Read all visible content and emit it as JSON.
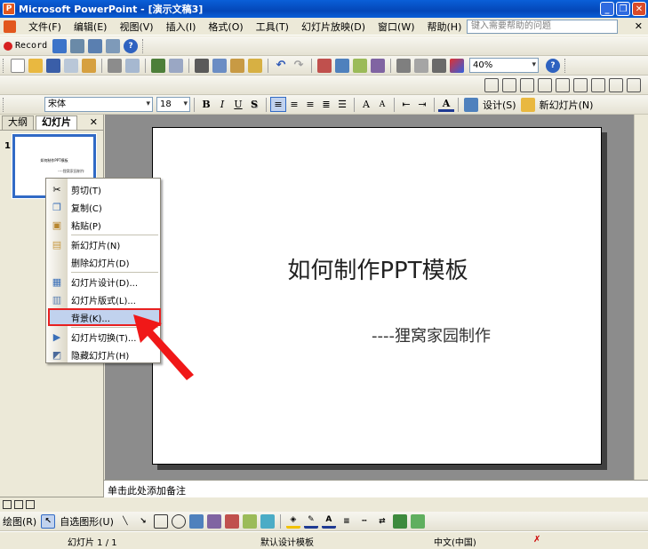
{
  "titlebar": {
    "title": "Microsoft PowerPoint - [演示文稿3]",
    "app_icon": "P",
    "minimize": "_",
    "restore": "❐",
    "close": "✕"
  },
  "menubar": {
    "items": [
      "文件(F)",
      "编辑(E)",
      "视图(V)",
      "插入(I)",
      "格式(O)",
      "工具(T)",
      "幻灯片放映(D)",
      "窗口(W)",
      "帮助(H)"
    ],
    "help_placeholder": "键入需要帮助的问题",
    "doc_close": "✕"
  },
  "toolbar_record": {
    "label": "Record"
  },
  "toolbar_standard": {
    "zoom": "40%"
  },
  "toolbar_format": {
    "font": "宋体",
    "size": "18",
    "bold": "B",
    "italic": "I",
    "underline": "U",
    "shadow": "S",
    "design_label": "设计(S)",
    "new_slide_label": "新幻灯片(N)"
  },
  "leftpane": {
    "tabs": [
      "大纲",
      "幻灯片"
    ],
    "close": "✕",
    "slide_number": "1",
    "thumb_title": "如何制作PPT模板",
    "thumb_sub": "----狸窝家园制作"
  },
  "slide": {
    "title": "如何制作PPT模板",
    "subtitle": "----狸窝家园制作"
  },
  "context_menu": {
    "items": [
      {
        "label": "剪切(T)",
        "icon": "scissors-icon"
      },
      {
        "label": "复制(C)",
        "icon": "copy-icon"
      },
      {
        "label": "粘贴(P)",
        "icon": "paste-icon"
      },
      {
        "label": "新幻灯片(N)",
        "icon": "new-slide-icon"
      },
      {
        "label": "删除幻灯片(D)",
        "icon": ""
      },
      {
        "label": "幻灯片设计(D)...",
        "icon": "slide-design-icon"
      },
      {
        "label": "幻灯片版式(L)...",
        "icon": "slide-layout-icon"
      },
      {
        "label": "背景(K)...",
        "icon": ""
      },
      {
        "label": "幻灯片切换(T)...",
        "icon": "transition-icon"
      },
      {
        "label": "隐藏幻灯片(H)",
        "icon": "hide-slide-icon"
      }
    ]
  },
  "notes": {
    "placeholder": "单击此处添加备注"
  },
  "drawbar": {
    "draw_label": "绘图(R)",
    "autoshapes_label": "自选图形(U)"
  },
  "statusbar": {
    "slide_info": "幻灯片 1 / 1",
    "template": "默认设计模板",
    "language": "中文(中国)"
  }
}
